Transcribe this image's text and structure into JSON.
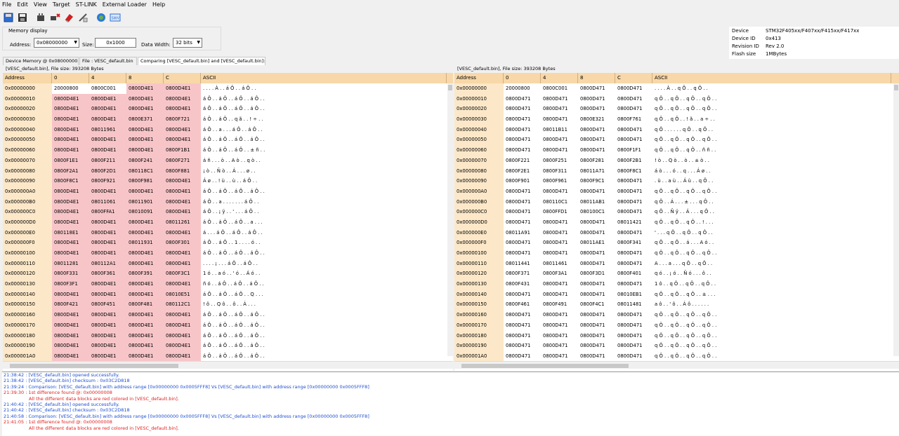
{
  "menu": [
    "File",
    "Edit",
    "View",
    "Target",
    "ST-LINK",
    "External Loader",
    "Help"
  ],
  "toolbar_icons": [
    "new-icon",
    "save-icon",
    "connect-icon",
    "disconnect-icon",
    "erase-icon",
    "program-icon",
    "target-icon",
    "swv-icon"
  ],
  "memory_display": {
    "label": "Memory display",
    "address_label": "Address:",
    "address_value": "0x08000000",
    "size_label": "Size:",
    "size_value": "0x1000",
    "width_label": "Data Width:",
    "width_value": "32 bits"
  },
  "device_info": [
    [
      "Device",
      "STM32F405xx/F407xx/F415xx/F417xx"
    ],
    [
      "Device ID",
      "0x413"
    ],
    [
      "Revision ID",
      "Rev 2.0"
    ],
    [
      "Flash size",
      "1MBytes"
    ]
  ],
  "tabs": [
    "Device Memory @ 0x08000000 :",
    "File : VESC_default.bin",
    "Comparing [VESC_default.bin] and [VESC_default.bin]:"
  ],
  "left_pane": {
    "file_info": "[VESC_default.bin], File size: 393208 Bytes",
    "headers": [
      "Address",
      "0",
      "4",
      "8",
      "C",
      "ASCII"
    ],
    "rows": [
      [
        "0x00000000",
        "20000800",
        "0800C001",
        "0800D4E1",
        "0800D4E1",
        ". . .  . À . . á Ô . . á Ô . ."
      ],
      [
        "0x00000010",
        "0800D4E1",
        "0800D4E1",
        "0800D4E1",
        "0800D4E1",
        "á Ô . . á Ô . . á Ô . . á Ô . ."
      ],
      [
        "0x00000020",
        "0800D4E1",
        "0800D4E1",
        "0800D4E1",
        "0800D4E1",
        "á Ô . . á Ô . . á Ô . . á Ô . ."
      ],
      [
        "0x00000030",
        "0800D4E1",
        "0800D4E1",
        "0800E371",
        "0800F721",
        "á Ô . . á Ô . . q ã . . ! ÷ . ."
      ],
      [
        "0x00000040",
        "0800D4E1",
        "08011961",
        "0800D4E1",
        "0800D4E1",
        "á Ô . . a . . . á Ô . . á Ô . ."
      ],
      [
        "0x00000050",
        "0800D4E1",
        "0800D4E1",
        "0800D4E1",
        "0800D4E1",
        "á Ô . . á Ô . . á Ô . . á Ô . ."
      ],
      [
        "0x00000060",
        "0800D4E1",
        "0800D4E1",
        "0800D4E1",
        "0800F1B1",
        "á Ô . . á Ô . . á Ô . . ± ñ . ."
      ],
      [
        "0x00000070",
        "0800F1E1",
        "0800F211",
        "0800F241",
        "0800F271",
        "á ñ . . . ò . . A ò . . q ò . ."
      ],
      [
        "0x00000080",
        "0800F2A1",
        "0800F2D1",
        "080118C1",
        "0800F881",
        "¡ ò . . Ñ ò . . Á . . . ø . ."
      ],
      [
        "0x00000090",
        "0800F8C1",
        "0800F921",
        "0800F981",
        "0800D4E1",
        "Á ø . . ! ù . . ù . . á Ô . ."
      ],
      [
        "0x000000A0",
        "0800D4E1",
        "0800D4E1",
        "0800D4E1",
        "0800D4E1",
        "á Ô . . á Ô . . á Ô . . á Ô . ."
      ],
      [
        "0x000000B0",
        "0800D4E1",
        "08011061",
        "08011901",
        "0800D4E1",
        "á Ô . . a . . . . . . . á Ô . ."
      ],
      [
        "0x000000C0",
        "0800D4E1",
        "0800FFA1",
        "08010091",
        "0800D4E1",
        "á Ô . . ¡ ÿ . . ' . . . á Ô . ."
      ],
      [
        "0x000000D0",
        "0800D4E1",
        "0800D4E1",
        "0800D4E1",
        "08011261",
        "á Ô . . á Ô . . á Ô . . a . . ."
      ],
      [
        "0x000000E0",
        "080118E1",
        "0800D4E1",
        "0800D4E1",
        "0800D4E1",
        "á . . . á Ô . . á Ô . . á Ô . ."
      ],
      [
        "0x000000F0",
        "0800D4E1",
        "0800D4E1",
        "08011931",
        "0800F301",
        "á Ô . . á Ô . . 1 . . . . ó . ."
      ],
      [
        "0x00000100",
        "0800D4E1",
        "0800D4E1",
        "0800D4E1",
        "0800D4E1",
        "á Ô . . á Ô . . á Ô . . á Ô . ."
      ],
      [
        "0x00000110",
        "08011281",
        "080112A1",
        "0800D4E1",
        "0800D4E1",
        ". . . . ¡ . . . á Ô . . á Ô . ."
      ],
      [
        "0x00000120",
        "0800F331",
        "0800F361",
        "0800F391",
        "0800F3C1",
        "1 ó . . a ó . . ' ó . . Á ó . ."
      ],
      [
        "0x00000130",
        "0800F3F1",
        "0800D4E1",
        "0800D4E1",
        "0800D4E1",
        "ñ ó . . á Ô . . á Ô . . á Ô . ."
      ],
      [
        "0x00000140",
        "0800D4E1",
        "0800D4E1",
        "0800D4E1",
        "08010E51",
        "á Ô . . á Ô . . á Ô . . Q . . ."
      ],
      [
        "0x00000150",
        "0800F421",
        "0800F451",
        "0800F481",
        "080112C1",
        "! ô . . Q ô . . ô . . Á . . ."
      ],
      [
        "0x00000160",
        "0800D4E1",
        "0800D4E1",
        "0800D4E1",
        "0800D4E1",
        "á Ô . . á Ô . . á Ô . . á Ô . ."
      ],
      [
        "0x00000170",
        "0800D4E1",
        "0800D4E1",
        "0800D4E1",
        "0800D4E1",
        "á Ô . . á Ô . . á Ô . . á Ô . ."
      ],
      [
        "0x00000180",
        "0800D4E1",
        "0800D4E1",
        "0800D4E1",
        "0800D4E1",
        "á Ô . . á Ô . . á Ô . . á Ô . ."
      ],
      [
        "0x00000190",
        "0800D4E1",
        "0800D4E1",
        "0800D4E1",
        "0800D4E1",
        "á Ô . . á Ô . . á Ô . . á Ô . ."
      ],
      [
        "0x000001A0",
        "0800D4E1",
        "0800D4E1",
        "0800D4E1",
        "0800D4E1",
        "á Ô . . á Ô . . á Ô . . á Ô . ."
      ]
    ]
  },
  "right_pane": {
    "file_info": "[VESC_default.bin], File size: 393208 Bytes",
    "headers": [
      "Address",
      "0",
      "4",
      "8",
      "C",
      "ASCII"
    ],
    "rows": [
      [
        "0x00000000",
        "20000800",
        "0800C001",
        "0800D471",
        "0800D471",
        ". . .  . À . . q Ô . . q Ô . ."
      ],
      [
        "0x00000010",
        "0800D471",
        "0800D471",
        "0800D471",
        "0800D471",
        "q Ô . . q Ô . . q Ô . . q Ô . ."
      ],
      [
        "0x00000020",
        "0800D471",
        "0800D471",
        "0800D471",
        "0800D471",
        "q Ô . . q Ô . . q Ô . . q Ô . ."
      ],
      [
        "0x00000030",
        "0800D471",
        "0800D471",
        "0800E321",
        "0800F761",
        "q Ô . . q Ô . . ! ã . . a ÷ . ."
      ],
      [
        "0x00000040",
        "0800D471",
        "08011B11",
        "0800D471",
        "0800D471",
        "q Ô . . . . . . q Ô . . q Ô . ."
      ],
      [
        "0x00000050",
        "0800D471",
        "0800D471",
        "0800D471",
        "0800D471",
        "q Ô . . q Ô . . q Ô . . q Ô . ."
      ],
      [
        "0x00000060",
        "0800D471",
        "0800D471",
        "0800D471",
        "0800F1F1",
        "q Ô . . q Ô . . q Ô . . ñ ñ . ."
      ],
      [
        "0x00000070",
        "0800F221",
        "0800F251",
        "0800F281",
        "0800F2B1",
        "! ò . . Q ò . . ò . . ± ò . ."
      ],
      [
        "0x00000080",
        "0800F2E1",
        "0800F311",
        "08011A71",
        "0800F8C1",
        "á ò . . . ó . . q . . . Á ø . ."
      ],
      [
        "0x00000090",
        "0800F901",
        "0800F961",
        "0800F9C1",
        "0800D471",
        ". ù . . a ù . . Á ù . . q Ô . ."
      ],
      [
        "0x000000A0",
        "0800D471",
        "0800D471",
        "0800D471",
        "0800D471",
        "q Ô . . q Ô . . q Ô . . q Ô . ."
      ],
      [
        "0x000000B0",
        "0800D471",
        "080110C1",
        "08011AB1",
        "0800D471",
        "q Ô . . Á . . . ± . . . q Ô . ."
      ],
      [
        "0x000000C0",
        "0800D471",
        "0800FFD1",
        "080100C1",
        "0800D471",
        "q Ô . . Ñ ÿ . . Á . . . q Ô . ."
      ],
      [
        "0x000000D0",
        "0800D471",
        "0800D471",
        "0800D471",
        "08011421",
        "q Ô . . q Ô . . q Ô . . ! . . ."
      ],
      [
        "0x000000E0",
        "08011A91",
        "0800D471",
        "0800D471",
        "0800D471",
        "' . . . q Ô . . q Ô . . q Ô . ."
      ],
      [
        "0x000000F0",
        "0800D471",
        "0800D471",
        "08011AE1",
        "0800F341",
        "q Ô . . q Ô . . á . . . A ó . ."
      ],
      [
        "0x00000100",
        "0800D471",
        "0800D471",
        "0800D471",
        "0800D471",
        "q Ô . . q Ô . . q Ô . . q Ô . ."
      ],
      [
        "0x00000110",
        "08011441",
        "08011461",
        "0800D471",
        "0800D471",
        "A . . . a . . . q Ô . . q Ô . ."
      ],
      [
        "0x00000120",
        "0800F371",
        "0800F3A1",
        "0800F3D1",
        "0800F401",
        "q ó . . ¡ ó . . Ñ ó . . . ô . ."
      ],
      [
        "0x00000130",
        "0800F431",
        "0800D471",
        "0800D471",
        "0800D471",
        "1 ô . . q Ô . . q Ô . . q Ô . ."
      ],
      [
        "0x00000140",
        "0800D471",
        "0800D471",
        "0800D471",
        "08010EB1",
        "q Ô . . q Ô . . q Ô . . ± . . ."
      ],
      [
        "0x00000150",
        "0800F461",
        "0800F491",
        "0800F4C1",
        "08011481",
        "a ô . . ' ô . . Á ô . . . . . ."
      ],
      [
        "0x00000160",
        "0800D471",
        "0800D471",
        "0800D471",
        "0800D471",
        "q Ô . . q Ô . . q Ô . . q Ô . ."
      ],
      [
        "0x00000170",
        "0800D471",
        "0800D471",
        "0800D471",
        "0800D471",
        "q Ô . . q Ô . . q Ô . . q Ô . ."
      ],
      [
        "0x00000180",
        "0800D471",
        "0800D471",
        "0800D471",
        "0800D471",
        "q Ô . . q Ô . . q Ô . . q Ô . ."
      ],
      [
        "0x00000190",
        "0800D471",
        "0800D471",
        "0800D471",
        "0800D471",
        "q Ô . . q Ô . . q Ô . . q Ô . ."
      ],
      [
        "0x000001A0",
        "0800D471",
        "0800D471",
        "0800D471",
        "0800D471",
        "q Ô . . q Ô . . q Ô . . q Ô . ."
      ]
    ]
  },
  "log": [
    {
      "t": "21:38:42 : [VESC_default.bin] opened successfully.",
      "c": "blue"
    },
    {
      "t": "21:38:42 : [VESC_default.bin] checksum : 0x03C2D818",
      "c": "blue"
    },
    {
      "t": "21:39:24 : Comparison: [VESC_default.bin] with address range [0x00000000 0x0005FFF8] Vs [VESC_default.bin] with address range [0x00000000 0x0005FFF8]",
      "c": "blue"
    },
    {
      "t": "21:39:30 : 1st difference found @: 0x00000008",
      "c": "red"
    },
    {
      "t": "All the different data blocks are red colored in [VESC_default.bin].",
      "c": "red",
      "ind": true
    },
    {
      "t": "21:40:42 : [VESC_default.bin] opened successfully.",
      "c": "blue"
    },
    {
      "t": "21:40:42 : [VESC_default.bin] checksum : 0x03C2D818",
      "c": "blue"
    },
    {
      "t": "21:40:58 : Comparison: [VESC_default.bin] with address range [0x00000000 0x0005FFF8] Vs [VESC_default.bin] with address range [0x00000000 0x0005FFF8]",
      "c": "blue"
    },
    {
      "t": "21:41:05 : 1st difference found @: 0x00000008",
      "c": "red"
    },
    {
      "t": "All the different data blocks are red colored in [VESC_default.bin].",
      "c": "red",
      "ind": true
    }
  ]
}
